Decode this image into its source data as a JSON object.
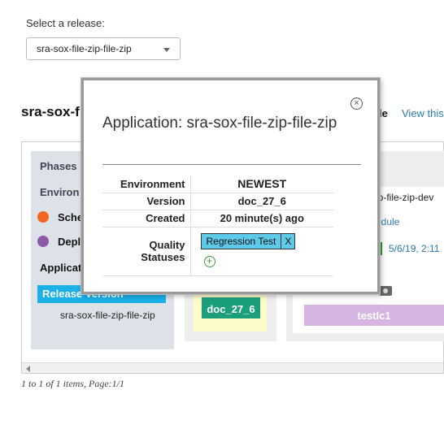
{
  "release_selector": {
    "label": "Select a release:",
    "selected": "sra-sox-file-zip-file-zip"
  },
  "background": {
    "heading": "sra-sox-f",
    "heading_tail": "le",
    "view_link": "View this",
    "left_panel": {
      "phases": "Phases",
      "environments": "Environ",
      "item1": "Sche",
      "item2": "Depl",
      "applications": "Applicat",
      "release_version": "Release Version",
      "release_name": "sra-sox-file-zip-file-zip"
    },
    "version_chip": "doc_27_6",
    "right_text": "ip-file-zip-dev",
    "right_link": "edule",
    "right_date": "5/6/19, 2:11",
    "lc_label": "testlc1",
    "pager": "1 to 1 of 1 items, Page:1/1"
  },
  "modal": {
    "title": "Application: sra-sox-file-zip-file-zip",
    "close_symbol": "×",
    "rows": [
      {
        "label": "Environment",
        "value": "NEWEST"
      },
      {
        "label": "Version",
        "value": "doc_27_6"
      },
      {
        "label": "Created",
        "value": "20 minute(s) ago"
      }
    ],
    "quality_label": "Quality Statuses",
    "quality_tag": "Regression Test",
    "quality_tag_remove": "X",
    "add_symbol": "+"
  },
  "colors": {
    "accent_blue": "#1ab0e8",
    "version_green": "#1a9e7c",
    "lc_purple": "#d7b5e3",
    "tag_blue": "#5fc9ea",
    "sched_orange": "#f26522",
    "deploy_purple": "#8e5aa8"
  }
}
